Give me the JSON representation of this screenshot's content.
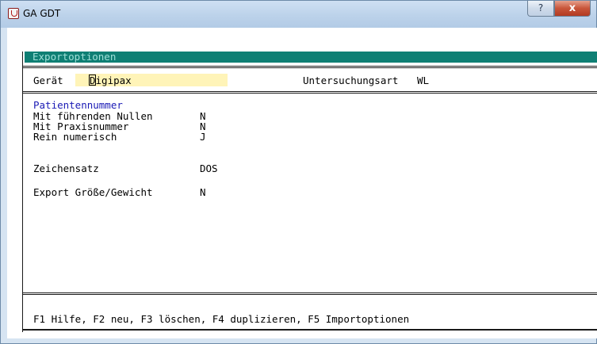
{
  "window": {
    "title": "GA GDT",
    "help_button": "?",
    "close_button": "x"
  },
  "panel": {
    "title": "Exportoptionen"
  },
  "device": {
    "label": "Gerät",
    "value": "Digipax",
    "exam_type_label": "Untersuchungsart",
    "exam_type_value": "WL"
  },
  "options": {
    "section_title": "Patientennummer",
    "leading_zeros_label": "Mit führenden Nullen",
    "leading_zeros_value": "N",
    "practice_number_label": "Mit Praxisnummer",
    "practice_number_value": "N",
    "numeric_only_label": "Rein numerisch",
    "numeric_only_value": "J",
    "charset_label": "Zeichensatz",
    "charset_value": "DOS",
    "export_size_weight_label": "Export Größe/Gewicht",
    "export_size_weight_value": "N"
  },
  "footer": {
    "keys": "F1 Hilfe, F2 neu, F3 löschen, F4 duplizieren, F5 Importoptionen"
  },
  "colors": {
    "panel_header_bg": "#0f7f74",
    "panel_header_text": "#9fe0d8",
    "field_highlight": "#fff4b8",
    "section_label": "#1a1ab5",
    "close_button": "#c8553a"
  }
}
